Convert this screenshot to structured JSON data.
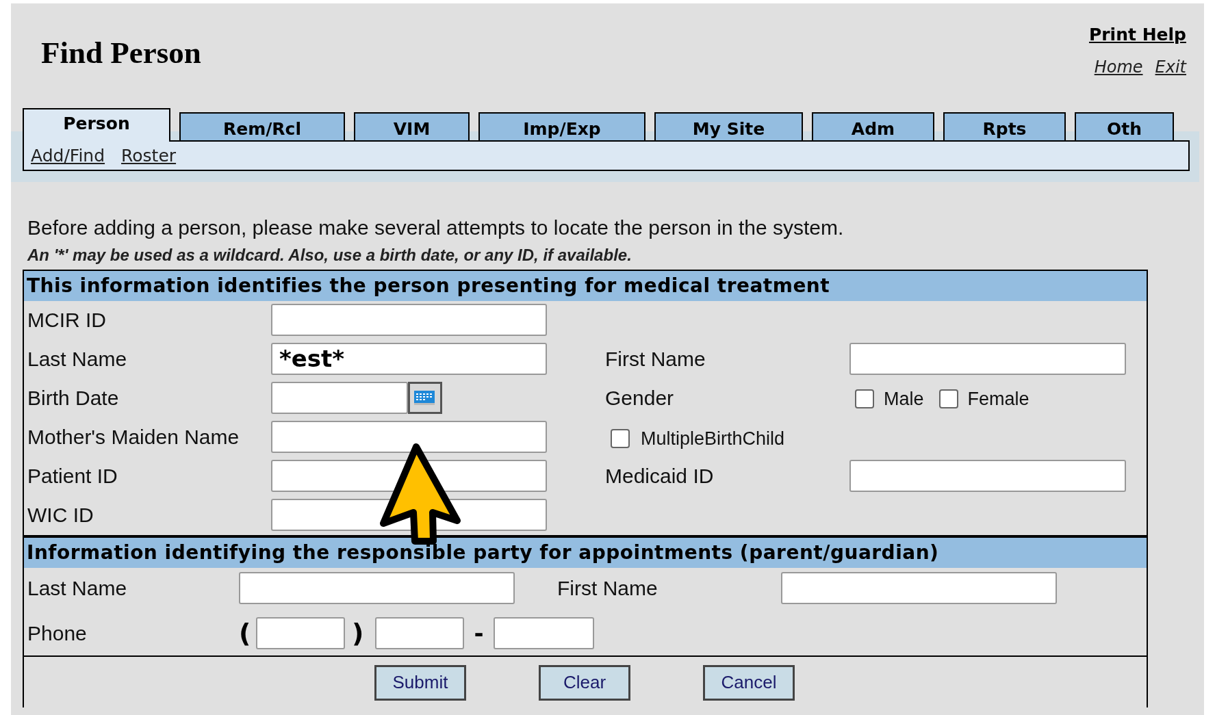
{
  "page": {
    "title": "Find Person"
  },
  "header_links": [
    {
      "label": "Print Help",
      "kind": "bold"
    }
  ],
  "nav_links": [
    {
      "label": "Home"
    },
    {
      "label": "Exit"
    }
  ],
  "tabs": [
    {
      "label": "Person",
      "selected": true
    },
    {
      "label": "Rem/Rcl",
      "selected": false
    },
    {
      "label": "VIM",
      "selected": false
    },
    {
      "label": "Imp/Exp",
      "selected": false
    },
    {
      "label": "My Site",
      "selected": false
    },
    {
      "label": "Adm",
      "selected": false
    },
    {
      "label": "Rpts",
      "selected": false
    },
    {
      "label": "Oth",
      "selected": false
    }
  ],
  "subtabs": [
    {
      "label": "Add/Find"
    },
    {
      "label": "Roster"
    }
  ],
  "instructions": {
    "main": "Before adding a person, please make several attempts to locate the person in the system.",
    "note": "An '*' may be used as a wildcard. Also, use a birth date, or any ID, if available."
  },
  "patient_section": {
    "heading": "This information identifies the person presenting for medical treatment",
    "rows": [
      {
        "left": {
          "kind": "field",
          "label": "MCIR ID"
        }
      },
      {
        "left": {
          "kind": "field",
          "label": "Last Name",
          "value": "*est*"
        },
        "right": {
          "kind": "field",
          "label": "First Name"
        }
      },
      {
        "left": {
          "kind": "date",
          "label": "Birth Date"
        },
        "right": {
          "kind": "choices",
          "label": "Gender",
          "options": [
            {
              "label": "Male",
              "checked": false
            },
            {
              "label": "Female",
              "checked": false
            }
          ]
        }
      },
      {
        "left": {
          "kind": "field",
          "label": "Mother's Maiden Name"
        },
        "right": {
          "kind": "checkbox",
          "label": "MultipleBirthChild",
          "checked": false
        }
      },
      {
        "left": {
          "kind": "field",
          "label": "Patient ID"
        },
        "right": {
          "kind": "field",
          "label": "Medicaid ID"
        }
      },
      {
        "left": {
          "kind": "field",
          "label": "WIC ID"
        }
      }
    ]
  },
  "guardian_section": {
    "heading": "Information identifying the responsible party for appointments (parent/guardian)",
    "last_name": {
      "label": "Last Name"
    },
    "first_name": {
      "label": "First Name"
    },
    "phone": {
      "label": "Phone",
      "open": "(",
      "close": ")",
      "dash": "-"
    }
  },
  "buttons": [
    {
      "label": "Submit"
    },
    {
      "label": "Clear"
    },
    {
      "label": "Cancel"
    }
  ]
}
